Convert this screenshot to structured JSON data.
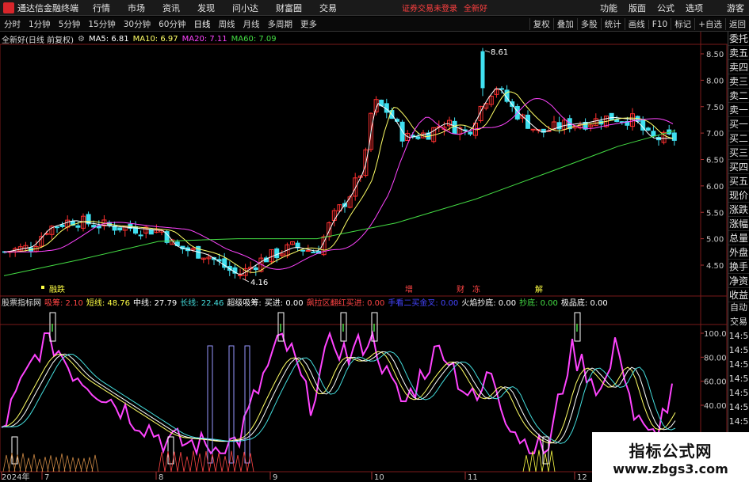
{
  "titlebar": {
    "app_title": "通达信金融终端",
    "menu": [
      "行情",
      "市场",
      "资讯",
      "发现",
      "问小达",
      "财富圈",
      "交易"
    ],
    "login_warning": "证券交易未登录",
    "stock_name": "全新好",
    "right_menu": [
      "功能",
      "版面",
      "公式",
      "选项"
    ],
    "guest": "游客"
  },
  "toolbar": {
    "periods": [
      "分时",
      "1分钟",
      "5分钟",
      "15分钟",
      "30分钟",
      "60分钟",
      "日线",
      "周线",
      "月线",
      "多周期",
      "更多"
    ],
    "active_period": "日线",
    "right_tools": [
      "复权",
      "叠加",
      "多股",
      "统计",
      "画线",
      "F10",
      "标记",
      "+自选",
      "返回"
    ]
  },
  "price_chart": {
    "title": "全新好(日线 前复权)",
    "ma": [
      {
        "label": "MA5: 6.81",
        "color": "#ffffff"
      },
      {
        "label": "MA10: 6.97",
        "color": "#ffff66"
      },
      {
        "label": "MA20: 7.11",
        "color": "#ff44ff"
      },
      {
        "label": "MA60: 7.09",
        "color": "#44dd44"
      }
    ],
    "high_label": "8.61",
    "low_label": "4.16",
    "axis_ticks": [
      "8.50",
      "8.00",
      "7.50",
      "7.00",
      "6.50",
      "6.00",
      "5.50",
      "5.00",
      "4.50"
    ],
    "markers": [
      {
        "text": "融跌",
        "color": "#ffff44"
      },
      {
        "text": "增",
        "color": "#ff4444"
      },
      {
        "text": "财",
        "color": "#ff4444"
      },
      {
        "text": "冻",
        "color": "#ff4444"
      },
      {
        "text": "解",
        "color": "#ffff44"
      }
    ]
  },
  "indicator": {
    "name": "股票指标网",
    "items": [
      {
        "label": "吸筹: 2.10",
        "color": "#ff4444"
      },
      {
        "label": "短线: 48.76",
        "color": "#ffff44"
      },
      {
        "label": "中线: 27.79",
        "color": "#ffffff"
      },
      {
        "label": "长线: 22.46",
        "color": "#44dddd"
      },
      {
        "label": "超级吸筹: ",
        "color": "#ffffff"
      },
      {
        "label": "买进: 0.00",
        "color": "#ffffff"
      },
      {
        "label": "飙拉区翻红买进: 0.00",
        "color": "#ff4444"
      },
      {
        "label": "手看二买金叉: 0.00",
        "color": "#4444ff"
      },
      {
        "label": "火焰抄底: 0.00",
        "color": "#ffffff"
      },
      {
        "label": "抄底: 0.00",
        "color": "#44dd44"
      },
      {
        "label": "极品底: 0.00",
        "color": "#ffffff"
      }
    ],
    "axis_ticks": [
      "100.0",
      "80.00",
      "60.00",
      "40.00"
    ]
  },
  "time_axis": [
    "2024年",
    "7",
    "8",
    "9",
    "10",
    "11",
    "12"
  ],
  "right_panel": [
    "委托",
    "卖五",
    "卖四",
    "卖三",
    "卖二",
    "卖一",
    "买一",
    "买二",
    "买三",
    "买四",
    "买五",
    "现价",
    "涨跌",
    "涨幅",
    "总量",
    "外盘",
    "换手",
    "净资",
    "收益"
  ],
  "right_panel2": [
    "自动",
    "交易",
    "14:5",
    "14:5",
    "14:5",
    "14:5",
    "14:5",
    "14:5",
    "14:5",
    "14:5",
    "14:5"
  ],
  "watermark": {
    "title": "指标公式网",
    "url": "www.zbgs3.com"
  }
}
